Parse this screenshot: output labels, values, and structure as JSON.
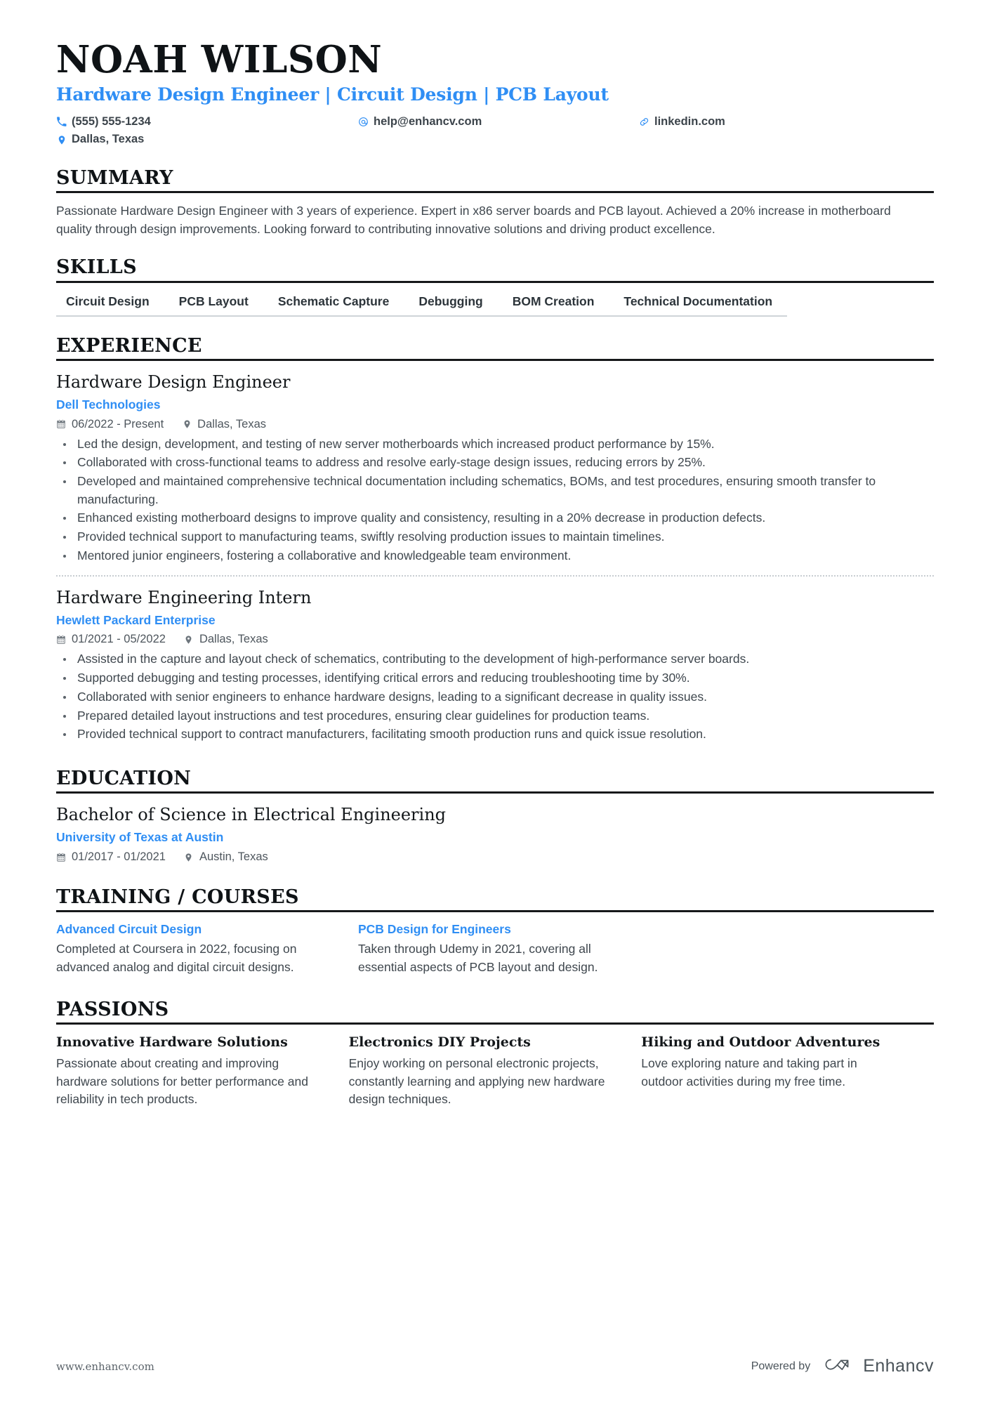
{
  "header": {
    "name": "NOAH WILSON",
    "headline": "Hardware Design Engineer | Circuit Design | PCB Layout",
    "contacts": [
      {
        "icon": "phone-icon",
        "text": "(555) 555-1234"
      },
      {
        "icon": "email-icon",
        "text": "help@enhancv.com"
      },
      {
        "icon": "link-icon",
        "text": "linkedin.com"
      },
      {
        "icon": "location-pin-icon",
        "text": "Dallas, Texas"
      }
    ]
  },
  "summary": {
    "title": "SUMMARY",
    "text": "Passionate Hardware Design Engineer with 3 years of experience. Expert in x86 server boards and PCB layout. Achieved a 20% increase in motherboard quality through design improvements. Looking forward to contributing innovative solutions and driving product excellence."
  },
  "skills": {
    "title": "SKILLS",
    "items": [
      "Circuit Design",
      "PCB Layout",
      "Schematic Capture",
      "Debugging",
      "BOM Creation",
      "Technical Documentation"
    ]
  },
  "experience": {
    "title": "EXPERIENCE",
    "entries": [
      {
        "role": "Hardware Design Engineer",
        "company": "Dell Technologies",
        "dates": "06/2022 - Present",
        "location": "Dallas, Texas",
        "bullets": [
          "Led the design, development, and testing of new server motherboards which increased product performance by 15%.",
          "Collaborated with cross-functional teams to address and resolve early-stage design issues, reducing errors by 25%.",
          "Developed and maintained comprehensive technical documentation including schematics, BOMs, and test procedures, ensuring smooth transfer to manufacturing.",
          "Enhanced existing motherboard designs to improve quality and consistency, resulting in a 20% decrease in production defects.",
          "Provided technical support to manufacturing teams, swiftly resolving production issues to maintain timelines.",
          "Mentored junior engineers, fostering a collaborative and knowledgeable team environment."
        ]
      },
      {
        "role": "Hardware Engineering Intern",
        "company": "Hewlett Packard Enterprise",
        "dates": "01/2021 - 05/2022",
        "location": "Dallas, Texas",
        "bullets": [
          "Assisted in the capture and layout check of schematics, contributing to the development of high-performance server boards.",
          "Supported debugging and testing processes, identifying critical errors and reducing troubleshooting time by 30%.",
          "Collaborated with senior engineers to enhance hardware designs, leading to a significant decrease in quality issues.",
          "Prepared detailed layout instructions and test procedures, ensuring clear guidelines for production teams.",
          "Provided technical support to contract manufacturers, facilitating smooth production runs and quick issue resolution."
        ]
      }
    ]
  },
  "education": {
    "title": "EDUCATION",
    "entries": [
      {
        "degree": "Bachelor of Science in Electrical Engineering",
        "school": "University of Texas at Austin",
        "dates": "01/2017 - 01/2021",
        "location": "Austin, Texas"
      }
    ]
  },
  "training": {
    "title": "TRAINING / COURSES",
    "courses": [
      {
        "name": "Advanced Circuit Design",
        "description": "Completed at Coursera in 2022, focusing on advanced analog and digital circuit designs."
      },
      {
        "name": "PCB Design for Engineers",
        "description": "Taken through Udemy in 2021, covering all essential aspects of PCB layout and design."
      }
    ]
  },
  "passions": {
    "title": "PASSIONS",
    "items": [
      {
        "name": "Innovative Hardware Solutions",
        "description": "Passionate about creating and improving hardware solutions for better performance and reliability in tech products."
      },
      {
        "name": "Electronics DIY Projects",
        "description": "Enjoy working on personal electronic projects, constantly learning and applying new hardware design techniques."
      },
      {
        "name": "Hiking and Outdoor Adventures",
        "description": "Love exploring nature and taking part in outdoor activities during my free time."
      }
    ]
  },
  "footer": {
    "website": "www.enhancv.com",
    "powered_by": "Powered by",
    "brand": "Enhancv"
  },
  "colors": {
    "accent": "#2f8ef4",
    "rule": "#16181a",
    "body_text": "#3f474e",
    "heading": "#0f1316"
  }
}
